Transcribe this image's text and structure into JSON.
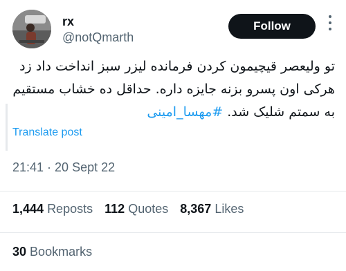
{
  "author": {
    "display_name": "rx",
    "handle": "@notQmarth",
    "avatar_icon": "avatar-photo"
  },
  "follow_label": "Follow",
  "more_icon": "more-vertical-icon",
  "tweet": {
    "text": "تو ولیعصر قیچیمون کردن فرمانده لیزر سبز انداخت داد زد هرکی اون پسرو بزنه جایزه داره. حداقل ده خشاب مستقیم به سمتم شلیک شد.",
    "hashtag": "#مهسا_امینی"
  },
  "translate_label": "Translate post",
  "timestamp": "21:41 · 20 Sept 22",
  "stats": {
    "reposts_count": "1,444",
    "reposts_label": "Reposts",
    "quotes_count": "112",
    "quotes_label": "Quotes",
    "likes_count": "8,367",
    "likes_label": "Likes"
  },
  "bookmarks": {
    "count": "30",
    "label": "Bookmarks"
  },
  "colors": {
    "text": "#0f1419",
    "secondary": "#536471",
    "link": "#1d9bf0",
    "divider": "#e6e9ec"
  }
}
